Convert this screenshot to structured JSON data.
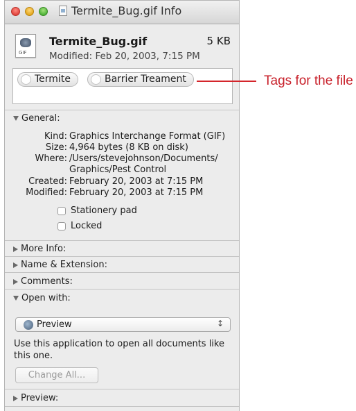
{
  "window": {
    "title": "Termite_Bug.gif Info"
  },
  "header": {
    "file_name": "Termite_Bug.gif",
    "file_size": "5 KB",
    "modified": "Modified: Feb 20, 2003, 7:15 PM"
  },
  "tags": [
    "Termite",
    "Barrier Treament"
  ],
  "callout": {
    "text": "Tags for the file",
    "color": "#c8202a"
  },
  "general": {
    "heading": "General:",
    "rows": [
      {
        "key": "Kind:",
        "value": "Graphics Interchange Format (GIF)"
      },
      {
        "key": "Size:",
        "value": "4,964 bytes (8 KB on disk)"
      },
      {
        "key": "Where:",
        "value": "/Users/stevejohnson/Documents/"
      },
      {
        "key": "",
        "value": "Graphics/Pest Control"
      },
      {
        "key": "Created:",
        "value": "February 20, 2003 at 7:15 PM"
      },
      {
        "key": "Modified:",
        "value": "February 20, 2003 at 7:15 PM"
      }
    ],
    "checkboxes": [
      {
        "label": "Stationery pad",
        "checked": false
      },
      {
        "label": "Locked",
        "checked": false
      }
    ]
  },
  "sections": {
    "more_info": "More Info:",
    "name_extension": "Name & Extension:",
    "comments": "Comments:",
    "open_with": "Open with:",
    "preview": "Preview:"
  },
  "open_with": {
    "app": "Preview",
    "app_icon": "preview-app-icon",
    "note": "Use this application to open all documents like this one.",
    "button": "Change All..."
  }
}
